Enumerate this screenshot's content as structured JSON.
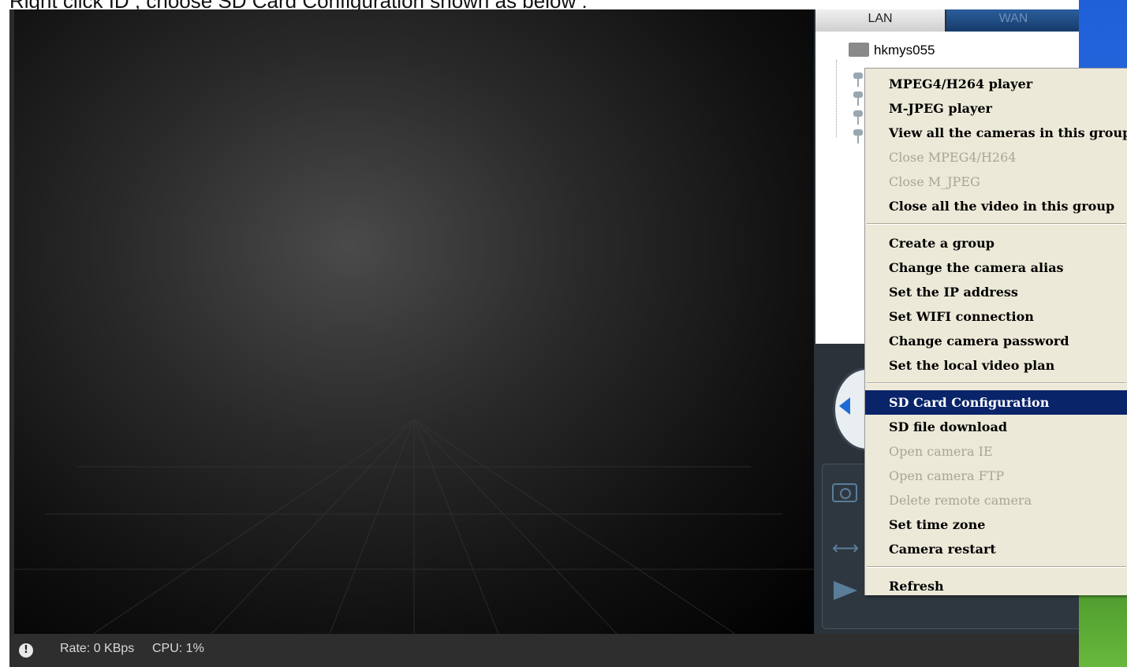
{
  "caption": "Right click ID , choose SD Card Configuration shown as below :",
  "tabs": {
    "lan": "LAN",
    "wan": "WAN"
  },
  "tree": {
    "root": "hkmys055"
  },
  "status": {
    "rate": "Rate: 0 KBps",
    "cpu": "CPU:  1%"
  },
  "menu": {
    "items": [
      {
        "label": "MPEG4/H264 player",
        "enabled": true
      },
      {
        "label": "M-JPEG player",
        "enabled": true
      },
      {
        "label": "View all the cameras in this group",
        "enabled": true
      },
      {
        "label": "Close MPEG4/H264",
        "enabled": false
      },
      {
        "label": "Close M_JPEG",
        "enabled": false
      },
      {
        "label": "Close all the video in this group",
        "enabled": true
      },
      {
        "label": "Create a group",
        "enabled": true
      },
      {
        "label": "Change the camera alias",
        "enabled": true
      },
      {
        "label": "Set the IP address",
        "enabled": true
      },
      {
        "label": "Set WIFI connection",
        "enabled": true
      },
      {
        "label": "Change camera password",
        "enabled": true
      },
      {
        "label": "Set the local video plan",
        "enabled": true
      },
      {
        "label": "SD Card Configuration",
        "enabled": true,
        "selected": true
      },
      {
        "label": "SD file download",
        "enabled": true
      },
      {
        "label": "Open camera IE",
        "enabled": false
      },
      {
        "label": "Open camera FTP",
        "enabled": false
      },
      {
        "label": "Delete remote camera",
        "enabled": false
      },
      {
        "label": "Set time zone",
        "enabled": true
      },
      {
        "label": "Camera restart",
        "enabled": true
      },
      {
        "label": "Refresh",
        "enabled": true
      }
    ]
  },
  "colors": {
    "menu_highlight": "#0a246a",
    "menu_bg": "#ece9d8",
    "tab_wan": "#1f4a80"
  }
}
